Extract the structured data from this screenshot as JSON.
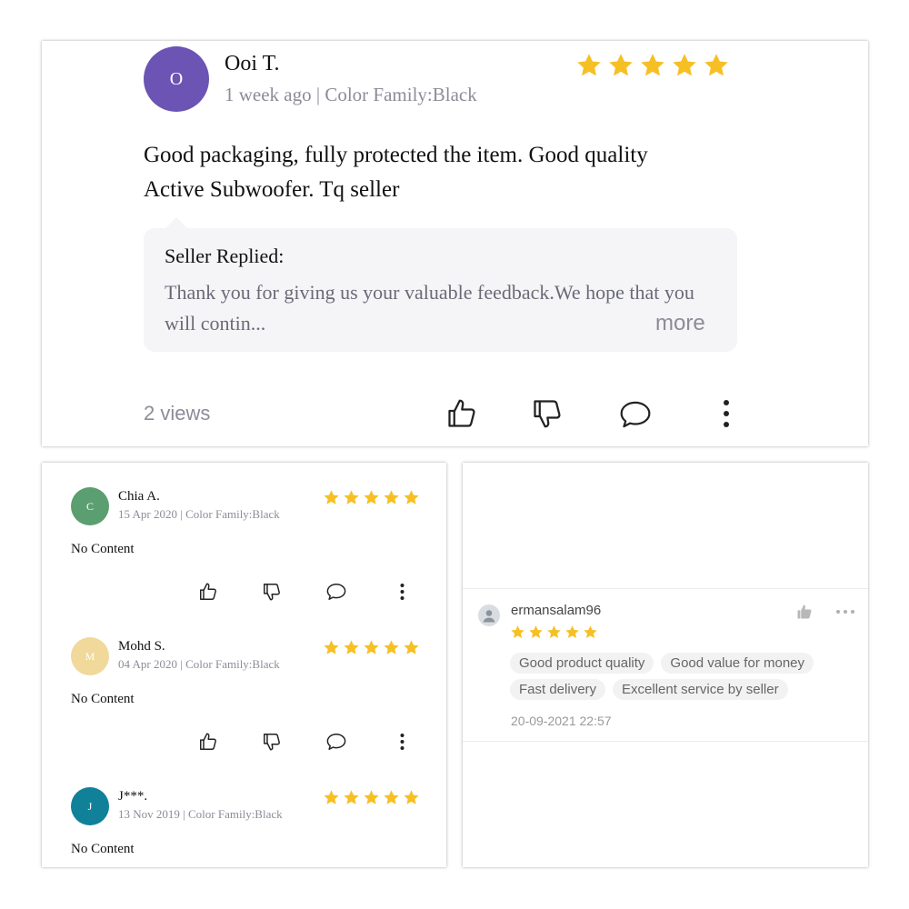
{
  "main_review": {
    "avatar_letter": "O",
    "avatar_color": "#6b54b4",
    "reviewer": "Ooi T.",
    "meta": "1 week ago | Color Family:Black",
    "rating": 5,
    "content": "Good packaging, fully protected the item. Good quality Active Subwoofer. Tq seller",
    "reply_title": "Seller Replied:",
    "reply_text": "Thank you for giving us your valuable feedback.We hope that you will contin...",
    "more_label": "more",
    "views": "2 views",
    "icons": [
      "thumbs-up-icon",
      "thumbs-down-icon",
      "comment-icon",
      "more-vertical-icon"
    ]
  },
  "left_reviews": [
    {
      "avatar_letter": "C",
      "avatar_color": "#5b9e70",
      "reviewer": "Chia A.",
      "meta": "15 Apr 2020 | Color Family:Black",
      "rating": 5,
      "content": "No Content"
    },
    {
      "avatar_letter": "M",
      "avatar_color": "#f0d99a",
      "reviewer": "Mohd S.",
      "meta": "04 Apr 2020 | Color Family:Black",
      "rating": 5,
      "content": "No Content"
    },
    {
      "avatar_letter": "J",
      "avatar_color": "#11819a",
      "reviewer": "J***.",
      "meta": "13 Nov 2019 | Color Family:Black",
      "rating": 5,
      "content": "No Content"
    }
  ],
  "right_review": {
    "username": "ermansalam96",
    "rating": 5,
    "tags": [
      "Good product quality",
      "Good value for money",
      "Fast delivery",
      "Excellent service by seller"
    ],
    "timestamp": "20-09-2021 22:57",
    "icons": [
      "user-avatar-icon",
      "like-icon",
      "more-horizontal-icon"
    ]
  },
  "colors": {
    "star": "#f6c025",
    "meta_text": "#8c8c99",
    "reply_bg": "#f5f5f7"
  }
}
